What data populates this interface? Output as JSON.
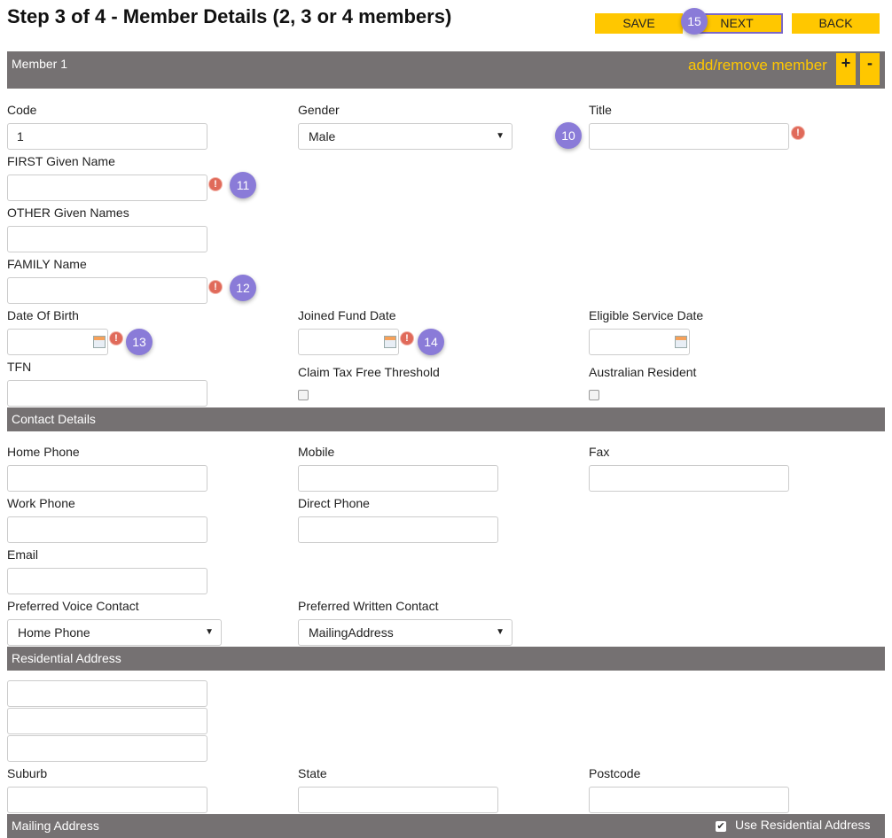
{
  "page_title": "Step 3 of 4 - Member Details (2, 3 or 4 members)",
  "toolbar": {
    "save": "SAVE",
    "next": "NEXT",
    "back": "BACK"
  },
  "member_bar": {
    "label": "Member 1",
    "add_remove": "add/remove member",
    "plus": "+",
    "minus": "-"
  },
  "fields": {
    "code": {
      "label": "Code",
      "value": "1"
    },
    "gender": {
      "label": "Gender",
      "value": "Male"
    },
    "title": {
      "label": "Title",
      "value": ""
    },
    "first_given": {
      "label": "FIRST Given Name",
      "value": ""
    },
    "other_given": {
      "label": "OTHER Given Names",
      "value": ""
    },
    "family": {
      "label": "FAMILY Name",
      "value": ""
    },
    "dob": {
      "label": "Date Of Birth",
      "value": ""
    },
    "joined": {
      "label": "Joined Fund Date",
      "value": ""
    },
    "eligible": {
      "label": "Eligible Service Date",
      "value": ""
    },
    "tfn": {
      "label": "TFN",
      "value": ""
    },
    "claim_tax": {
      "label": "Claim Tax Free Threshold",
      "checked": false
    },
    "aus_resident": {
      "label": "Australian Resident",
      "checked": false
    }
  },
  "contact_bar": "Contact Details",
  "contact": {
    "home_phone": "Home Phone",
    "mobile": "Mobile",
    "fax": "Fax",
    "work_phone": "Work Phone",
    "direct_phone": "Direct Phone",
    "email": "Email",
    "pref_voice": {
      "label": "Preferred Voice Contact",
      "value": "Home Phone"
    },
    "pref_written": {
      "label": "Preferred Written Contact",
      "value": "MailingAddress"
    }
  },
  "residential_bar": "Residential Address",
  "address": {
    "suburb": "Suburb",
    "state": "State",
    "postcode": "Postcode"
  },
  "mailing_bar": {
    "label": "Mailing Address",
    "use_residential": "Use Residential Address",
    "checked": true
  },
  "badges": {
    "b10": "10",
    "b11": "11",
    "b12": "12",
    "b13": "13",
    "b14": "14",
    "b15": "15"
  },
  "error_glyph": "!",
  "dropdown_arrow": "▼",
  "colors": {
    "accent": "#ffc700",
    "bar": "#757172",
    "badge": "#8a7bd8",
    "error": "#e06a5a"
  }
}
